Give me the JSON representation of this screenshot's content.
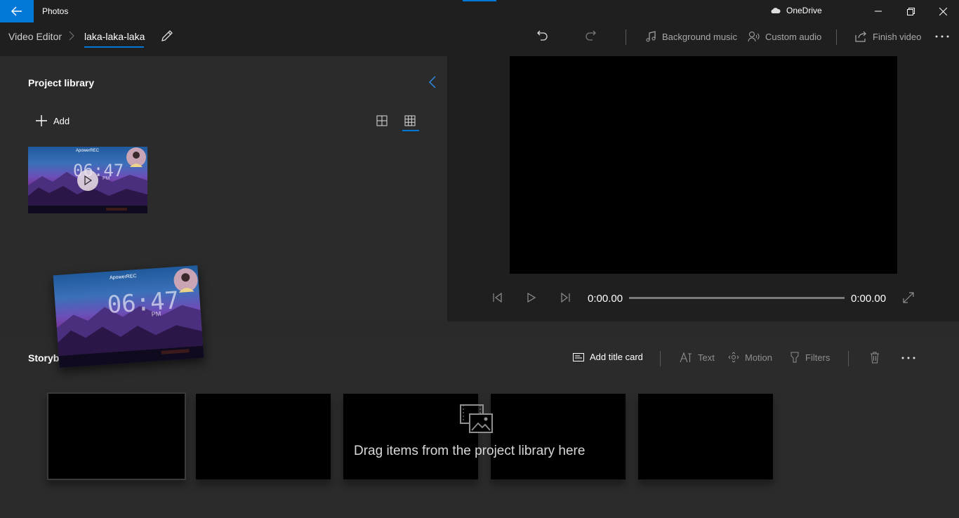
{
  "titlebar": {
    "app_title": "Photos",
    "onedrive_label": "OneDrive"
  },
  "toolbar": {
    "breadcrumb_root": "Video Editor",
    "project_name": "laka-laka-laka",
    "background_music": "Background music",
    "custom_audio": "Custom audio",
    "finish_video": "Finish video"
  },
  "library": {
    "title": "Project library",
    "add_label": "Add",
    "thumbnail": {
      "watermark": "ApowerREC",
      "clock": "06:47",
      "ampm": "PM"
    }
  },
  "player": {
    "current_time": "0:00.00",
    "total_time": "0:00.00",
    "progress": 0
  },
  "storyboard": {
    "title": "Storyboard",
    "add_title_card": "Add title card",
    "text": "Text",
    "motion": "Motion",
    "filters": "Filters",
    "drop_hint": "Drag items from the project library here"
  },
  "colors": {
    "accent": "#0078d7",
    "titlebar_bg": "#1f1f1f",
    "panel_bg": "#2b2b2b"
  }
}
